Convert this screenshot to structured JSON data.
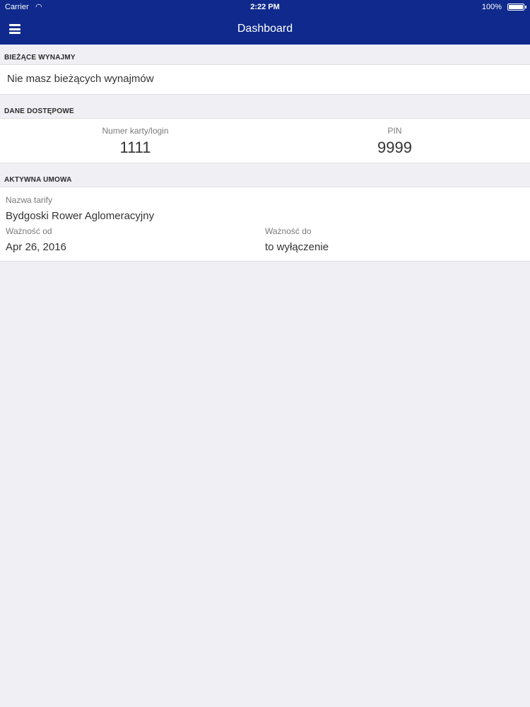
{
  "status_bar": {
    "carrier": "Carrier",
    "wifi_icon": "wifi-icon",
    "time": "2:22 PM",
    "battery": "100%"
  },
  "navbar": {
    "menu_icon": "hamburger-menu-icon",
    "title": "Dashboard"
  },
  "current_rentals": {
    "header": "BIEŻĄCE WYNAJMY",
    "empty_message": "Nie masz bieżących wynajmów"
  },
  "access_data": {
    "header": "DANE DOSTĘPOWE",
    "login_label": "Numer karty/login",
    "login_value": "1111",
    "pin_label": "PIN",
    "pin_value": "9999"
  },
  "active_contract": {
    "header": "AKTYWNA UMOWA",
    "tariff_label": "Nazwa tarify",
    "tariff_value": "Bydgoski Rower Aglomeracyjny",
    "valid_from_label": "Ważność od",
    "valid_from_value": "Apr 26, 2016",
    "valid_to_label": "Ważność do",
    "valid_to_value": "to wyłączenie"
  },
  "colors": {
    "navbar": "#0f2a8c",
    "background": "#efeff4",
    "card": "#ffffff"
  }
}
